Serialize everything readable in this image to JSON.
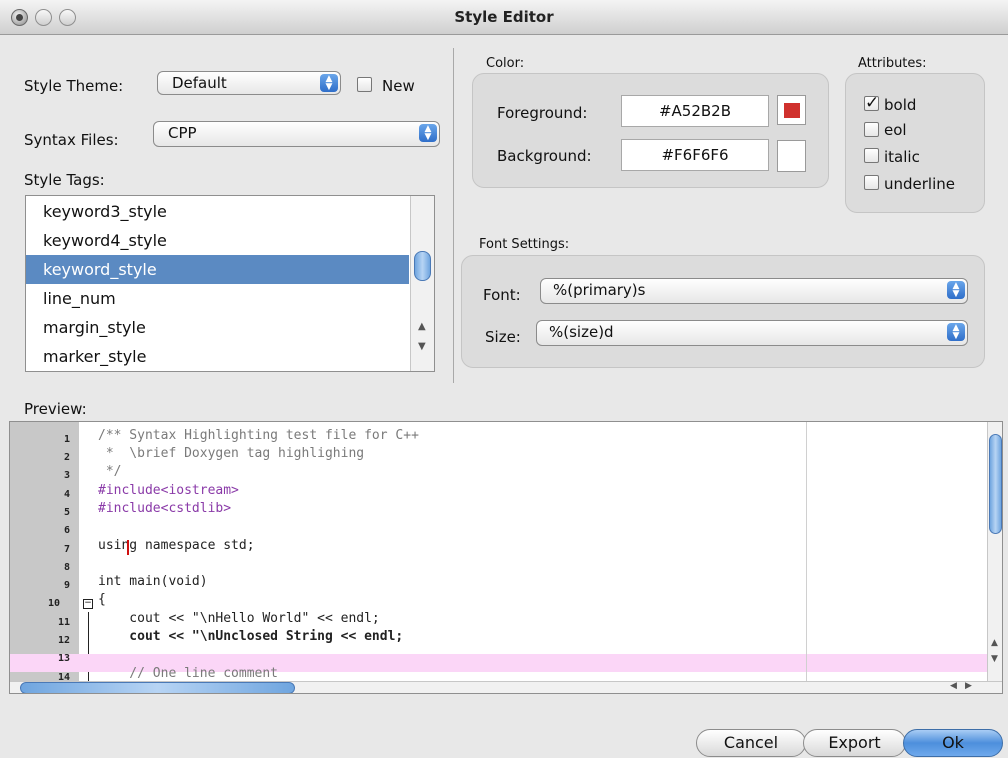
{
  "window": {
    "title": "Style Editor"
  },
  "theme": {
    "label": "Style Theme:",
    "value": "Default",
    "new_label": "New"
  },
  "syntax": {
    "label": "Syntax Files:",
    "value": "CPP"
  },
  "tags": {
    "label": "Style Tags:",
    "items": [
      "keyword3_style",
      "keyword4_style",
      "keyword_style",
      "line_num",
      "margin_style",
      "marker_style"
    ],
    "selected_index": 2
  },
  "color": {
    "label": "Color:",
    "foreground_label": "Foreground:",
    "foreground_value": "#A52B2B",
    "background_label": "Background:",
    "background_value": "#F6F6F6",
    "fg_swatch": "#d0312d",
    "bg_swatch": "#ffffff"
  },
  "attributes": {
    "label": "Attributes:",
    "items": [
      {
        "label": "bold",
        "checked": true
      },
      {
        "label": "eol",
        "checked": false
      },
      {
        "label": "italic",
        "checked": false
      },
      {
        "label": "underline",
        "checked": false
      }
    ]
  },
  "font": {
    "label": "Font Settings:",
    "font_label": "Font:",
    "font_value": "%(primary)s",
    "size_label": "Size:",
    "size_value": "%(size)d"
  },
  "preview": {
    "label": "Preview:",
    "line_numbers": [
      "1",
      "2",
      "3",
      "4",
      "5",
      "6",
      "7",
      "8",
      "9",
      "10",
      "11",
      "12",
      "13",
      "14"
    ],
    "lines": [
      "/** Syntax Highlighting test file for C++",
      " *  \\brief Doxygen tag highlighing",
      " */",
      "#include<iostream>",
      "#include<cstdlib>",
      "",
      "using namespace std;",
      "",
      "int main(void)",
      "{",
      "    cout << \"\\nHello World\" << endl;",
      "    cout << \"\\nUnclosed String << endl;",
      "",
      "    // One line comment"
    ]
  },
  "buttons": {
    "cancel": "Cancel",
    "export": "Export",
    "ok": "Ok"
  }
}
